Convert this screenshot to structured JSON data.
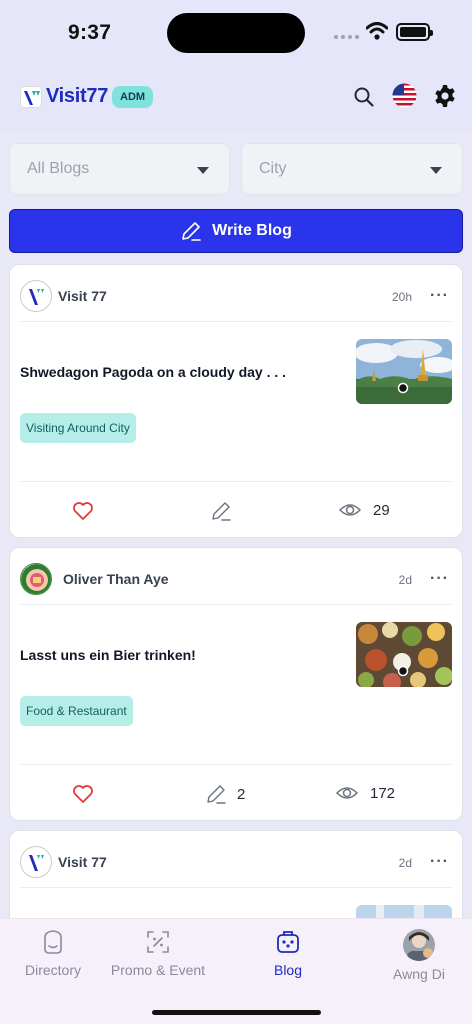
{
  "status_bar": {
    "time": "9:37"
  },
  "header": {
    "logo_text": "Visit77",
    "role_badge": "ADM",
    "icons": [
      "search-icon",
      "us-flag-icon",
      "gear-icon"
    ]
  },
  "filters": {
    "blog_filter": "All Blogs",
    "city_filter": "City"
  },
  "write_button": {
    "label": "Write Blog"
  },
  "posts": [
    {
      "author": "Visit 77",
      "time": "20h",
      "title": "Shwedagon Pagoda on a cloudy day . . .",
      "tag": "Visiting Around City",
      "comments": "",
      "views": "29"
    },
    {
      "author": "Oliver Than Aye",
      "time": "2d",
      "title": "Lasst uns ein Bier trinken!",
      "tag": "Food & Restaurant",
      "comments": "2",
      "views": "172"
    },
    {
      "author": "Visit 77",
      "time": "2d"
    }
  ],
  "bottom_nav": {
    "items": [
      {
        "label": "Directory",
        "icon": "directory-icon"
      },
      {
        "label": "Promo & Event",
        "icon": "promo-icon"
      },
      {
        "label": "Blog",
        "icon": "blog-icon",
        "active": true
      },
      {
        "label": "Awng Di",
        "icon": "profile-avatar"
      }
    ]
  },
  "colors": {
    "primary": "#2a34ea",
    "brand": "#1d2bbf",
    "tag_bg": "#b5eee8",
    "like": "#e23b3b"
  }
}
